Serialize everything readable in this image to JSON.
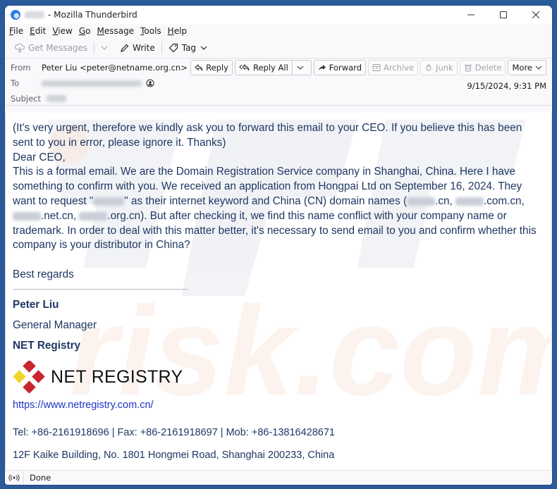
{
  "window": {
    "title": "- Mozilla Thunderbird",
    "controls": {
      "minimize": "minimize",
      "maximize": "maximize",
      "close": "close"
    }
  },
  "menubar": {
    "items": [
      {
        "label": "File",
        "accel": "F",
        "rest": "ile"
      },
      {
        "label": "Edit",
        "accel": "E",
        "rest": "dit"
      },
      {
        "label": "View",
        "accel": "V",
        "rest": "iew"
      },
      {
        "label": "Go",
        "accel": "G",
        "rest": "o"
      },
      {
        "label": "Message",
        "accel": "M",
        "rest": "essage"
      },
      {
        "label": "Tools",
        "accel": "T",
        "rest": "ools"
      },
      {
        "label": "Help",
        "accel": "H",
        "rest": "elp"
      }
    ]
  },
  "toolbar": {
    "get_messages": "Get Messages",
    "write": "Write",
    "tag": "Tag"
  },
  "header": {
    "from_label": "From",
    "from_value": "Peter Liu <peter@netname.org.cn>",
    "to_label": "To",
    "subject_label": "Subject",
    "date": "9/15/2024, 9:31 PM",
    "actions": {
      "reply": "Reply",
      "reply_all": "Reply All",
      "forward": "Forward",
      "archive": "Archive",
      "junk": "Junk",
      "delete": "Delete",
      "more": "More"
    }
  },
  "body": {
    "intro_1": "(It's very urgent, therefore we kindly ask you to forward this email to your CEO. If you believe this has been sent to you in error, please ignore it. Thanks)",
    "greeting": "Dear CEO,",
    "para_a": "This is a formal email. We are the Domain Registration Service company in Shanghai, China. Here I have something to confirm with you. We received an application from Hongpai Ltd on September 16, 2024. They want to request \"",
    "para_b": "\" as their internet keyword and China (CN) domain names (",
    "para_c": ".cn, ",
    "para_d": ".com.cn, ",
    "para_e": ".net.cn, ",
    "para_f": ".org.cn). But after checking it, we find this name conflict with your company name or trademark. In order to deal with this matter better, it's necessary to send email to you and confirm whether this company is your distributor in China?",
    "regards": "Best regards",
    "sig_name": "Peter Liu",
    "sig_title": "General Manager",
    "sig_company": "NET Registry",
    "logo_text": "NET REGISTRY",
    "logo_colors": {
      "red": "#c8252c",
      "yellow": "#f3d427"
    },
    "link": "https://www.netregistry.com.cn/",
    "contact": "Tel: +86-2161918696 | Fax: +86-2161918697 | Mob: +86-13816428671",
    "address": "12F Kaike Building, No. 1801 Hongmei Road, Shanghai 200233, China"
  },
  "statusbar": {
    "text": "Done"
  }
}
